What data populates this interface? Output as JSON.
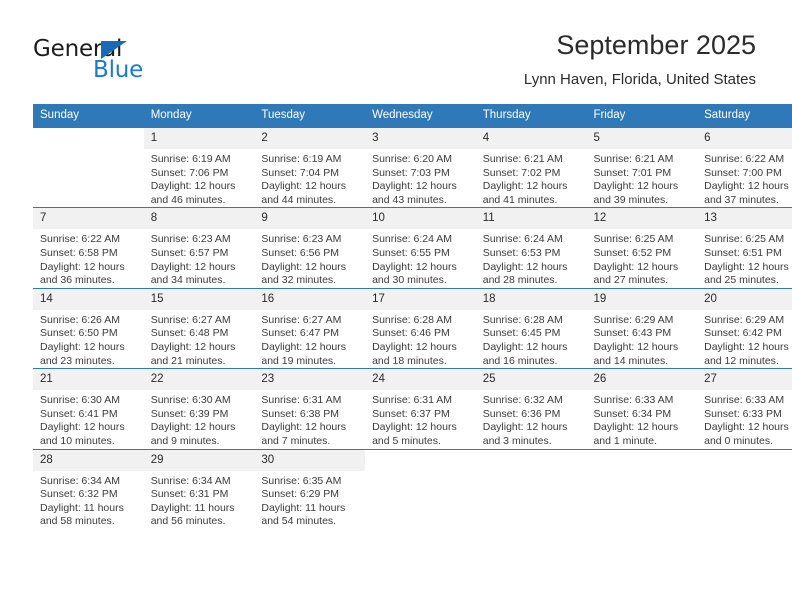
{
  "brand": {
    "line1": "General",
    "line2": "Blue",
    "triangle_color": "#1a6bb5",
    "blue_text_color": "#1a7ad1"
  },
  "header": {
    "title": "September 2025",
    "subtitle": "Lynn Haven, Florida, United States"
  },
  "theme": {
    "header_bg": "#3079b8",
    "daynum_bg": "#f1f1f1",
    "text": "#2b2b2b"
  },
  "labels": {
    "sunrise": "Sunrise:",
    "sunset": "Sunset:",
    "daylight": "Daylight:"
  },
  "weekdays": [
    "Sunday",
    "Monday",
    "Tuesday",
    "Wednesday",
    "Thursday",
    "Friday",
    "Saturday"
  ],
  "weeks": [
    [
      {
        "day": "",
        "sunrise": "",
        "sunset": "",
        "daylight": ""
      },
      {
        "day": "1",
        "sunrise": "Sunrise: 6:19 AM",
        "sunset": "Sunset: 7:06 PM",
        "daylight": "Daylight: 12 hours and 46 minutes."
      },
      {
        "day": "2",
        "sunrise": "Sunrise: 6:19 AM",
        "sunset": "Sunset: 7:04 PM",
        "daylight": "Daylight: 12 hours and 44 minutes."
      },
      {
        "day": "3",
        "sunrise": "Sunrise: 6:20 AM",
        "sunset": "Sunset: 7:03 PM",
        "daylight": "Daylight: 12 hours and 43 minutes."
      },
      {
        "day": "4",
        "sunrise": "Sunrise: 6:21 AM",
        "sunset": "Sunset: 7:02 PM",
        "daylight": "Daylight: 12 hours and 41 minutes."
      },
      {
        "day": "5",
        "sunrise": "Sunrise: 6:21 AM",
        "sunset": "Sunset: 7:01 PM",
        "daylight": "Daylight: 12 hours and 39 minutes."
      },
      {
        "day": "6",
        "sunrise": "Sunrise: 6:22 AM",
        "sunset": "Sunset: 7:00 PM",
        "daylight": "Daylight: 12 hours and 37 minutes."
      }
    ],
    [
      {
        "day": "7",
        "sunrise": "Sunrise: 6:22 AM",
        "sunset": "Sunset: 6:58 PM",
        "daylight": "Daylight: 12 hours and 36 minutes."
      },
      {
        "day": "8",
        "sunrise": "Sunrise: 6:23 AM",
        "sunset": "Sunset: 6:57 PM",
        "daylight": "Daylight: 12 hours and 34 minutes."
      },
      {
        "day": "9",
        "sunrise": "Sunrise: 6:23 AM",
        "sunset": "Sunset: 6:56 PM",
        "daylight": "Daylight: 12 hours and 32 minutes."
      },
      {
        "day": "10",
        "sunrise": "Sunrise: 6:24 AM",
        "sunset": "Sunset: 6:55 PM",
        "daylight": "Daylight: 12 hours and 30 minutes."
      },
      {
        "day": "11",
        "sunrise": "Sunrise: 6:24 AM",
        "sunset": "Sunset: 6:53 PM",
        "daylight": "Daylight: 12 hours and 28 minutes."
      },
      {
        "day": "12",
        "sunrise": "Sunrise: 6:25 AM",
        "sunset": "Sunset: 6:52 PM",
        "daylight": "Daylight: 12 hours and 27 minutes."
      },
      {
        "day": "13",
        "sunrise": "Sunrise: 6:25 AM",
        "sunset": "Sunset: 6:51 PM",
        "daylight": "Daylight: 12 hours and 25 minutes."
      }
    ],
    [
      {
        "day": "14",
        "sunrise": "Sunrise: 6:26 AM",
        "sunset": "Sunset: 6:50 PM",
        "daylight": "Daylight: 12 hours and 23 minutes."
      },
      {
        "day": "15",
        "sunrise": "Sunrise: 6:27 AM",
        "sunset": "Sunset: 6:48 PM",
        "daylight": "Daylight: 12 hours and 21 minutes."
      },
      {
        "day": "16",
        "sunrise": "Sunrise: 6:27 AM",
        "sunset": "Sunset: 6:47 PM",
        "daylight": "Daylight: 12 hours and 19 minutes."
      },
      {
        "day": "17",
        "sunrise": "Sunrise: 6:28 AM",
        "sunset": "Sunset: 6:46 PM",
        "daylight": "Daylight: 12 hours and 18 minutes."
      },
      {
        "day": "18",
        "sunrise": "Sunrise: 6:28 AM",
        "sunset": "Sunset: 6:45 PM",
        "daylight": "Daylight: 12 hours and 16 minutes."
      },
      {
        "day": "19",
        "sunrise": "Sunrise: 6:29 AM",
        "sunset": "Sunset: 6:43 PM",
        "daylight": "Daylight: 12 hours and 14 minutes."
      },
      {
        "day": "20",
        "sunrise": "Sunrise: 6:29 AM",
        "sunset": "Sunset: 6:42 PM",
        "daylight": "Daylight: 12 hours and 12 minutes."
      }
    ],
    [
      {
        "day": "21",
        "sunrise": "Sunrise: 6:30 AM",
        "sunset": "Sunset: 6:41 PM",
        "daylight": "Daylight: 12 hours and 10 minutes."
      },
      {
        "day": "22",
        "sunrise": "Sunrise: 6:30 AM",
        "sunset": "Sunset: 6:39 PM",
        "daylight": "Daylight: 12 hours and 9 minutes."
      },
      {
        "day": "23",
        "sunrise": "Sunrise: 6:31 AM",
        "sunset": "Sunset: 6:38 PM",
        "daylight": "Daylight: 12 hours and 7 minutes."
      },
      {
        "day": "24",
        "sunrise": "Sunrise: 6:31 AM",
        "sunset": "Sunset: 6:37 PM",
        "daylight": "Daylight: 12 hours and 5 minutes."
      },
      {
        "day": "25",
        "sunrise": "Sunrise: 6:32 AM",
        "sunset": "Sunset: 6:36 PM",
        "daylight": "Daylight: 12 hours and 3 minutes."
      },
      {
        "day": "26",
        "sunrise": "Sunrise: 6:33 AM",
        "sunset": "Sunset: 6:34 PM",
        "daylight": "Daylight: 12 hours and 1 minute."
      },
      {
        "day": "27",
        "sunrise": "Sunrise: 6:33 AM",
        "sunset": "Sunset: 6:33 PM",
        "daylight": "Daylight: 12 hours and 0 minutes."
      }
    ],
    [
      {
        "day": "28",
        "sunrise": "Sunrise: 6:34 AM",
        "sunset": "Sunset: 6:32 PM",
        "daylight": "Daylight: 11 hours and 58 minutes."
      },
      {
        "day": "29",
        "sunrise": "Sunrise: 6:34 AM",
        "sunset": "Sunset: 6:31 PM",
        "daylight": "Daylight: 11 hours and 56 minutes."
      },
      {
        "day": "30",
        "sunrise": "Sunrise: 6:35 AM",
        "sunset": "Sunset: 6:29 PM",
        "daylight": "Daylight: 11 hours and 54 minutes."
      },
      {
        "day": "",
        "sunrise": "",
        "sunset": "",
        "daylight": ""
      },
      {
        "day": "",
        "sunrise": "",
        "sunset": "",
        "daylight": ""
      },
      {
        "day": "",
        "sunrise": "",
        "sunset": "",
        "daylight": ""
      },
      {
        "day": "",
        "sunrise": "",
        "sunset": "",
        "daylight": ""
      }
    ]
  ]
}
